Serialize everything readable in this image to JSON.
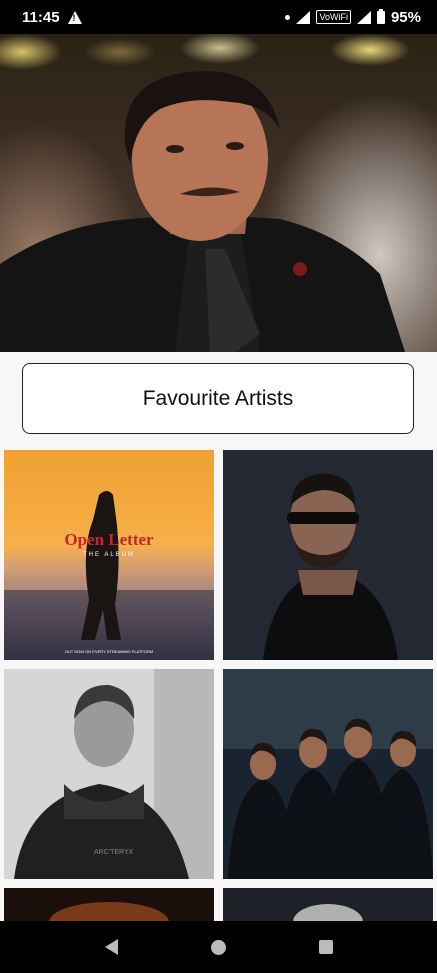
{
  "status_bar": {
    "time": "11:45",
    "vowifi": "VoWiFi",
    "battery": "95%"
  },
  "hero": {
    "image": "artist-portrait-photo"
  },
  "favourite_button": {
    "label": "Favourite Artists"
  },
  "artists": [
    {
      "image": "open-letter-album-cover",
      "title": "Open Letter",
      "subtitle": "THE ALBUM",
      "footer": "OUT NOW ON EVERY STREAMING PLATFORM"
    },
    {
      "image": "artist-sunglasses-photo"
    },
    {
      "image": "artist-bw-portrait-photo"
    },
    {
      "image": "group-of-four-artists-photo"
    },
    {
      "image": "artist-photo-partial-5"
    },
    {
      "image": "artist-photo-partial-6"
    }
  ],
  "nav_bar": {
    "back": "back-icon",
    "home": "home-icon",
    "recents": "recents-icon"
  }
}
